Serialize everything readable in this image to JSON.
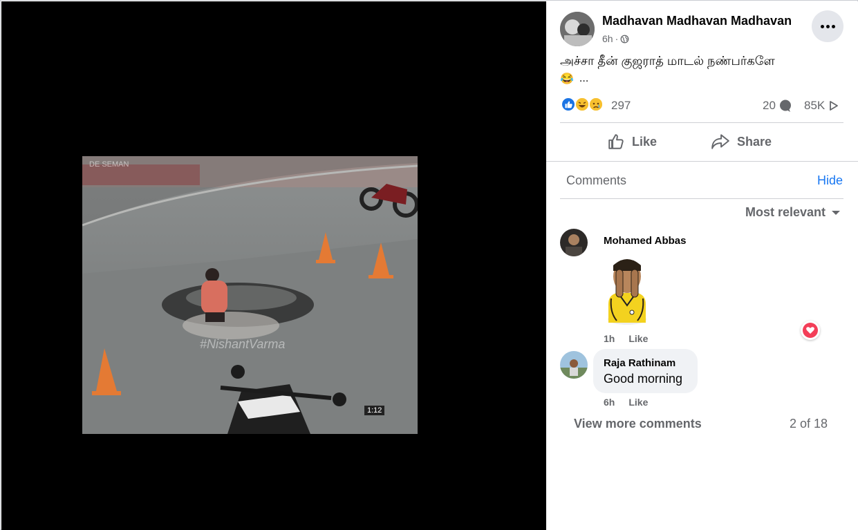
{
  "post": {
    "author": "Madhavan Madhavan Madhavan",
    "time": "6h",
    "separator": "·",
    "text": "அச்சா தீன் குஜராத் மாடல் நண்பர்களே",
    "emoji": "😂",
    "see_more": "...",
    "reaction_count": "297",
    "comment_count": "20",
    "share_count": "85K"
  },
  "media": {
    "watermark": "#NishantVarma",
    "top_caption": "DE SEMAN",
    "corner_badge": "1:12"
  },
  "actions": {
    "like": "Like",
    "share": "Share"
  },
  "comments_section": {
    "title": "Comments",
    "hide": "Hide",
    "sort": "Most relevant",
    "view_more": "View more comments",
    "pager": "2 of 18",
    "items": [
      {
        "author": "Mohamed Abbas",
        "text": "",
        "time": "1h",
        "like": "Like"
      },
      {
        "author": "Raja Rathinam",
        "text": "Good morning",
        "time": "6h",
        "like": "Like"
      }
    ]
  },
  "colors": {
    "accent": "#1877f2",
    "like_blue": "#1b74e4",
    "love_red": "#f33e58",
    "secondary_text": "#65676b"
  }
}
